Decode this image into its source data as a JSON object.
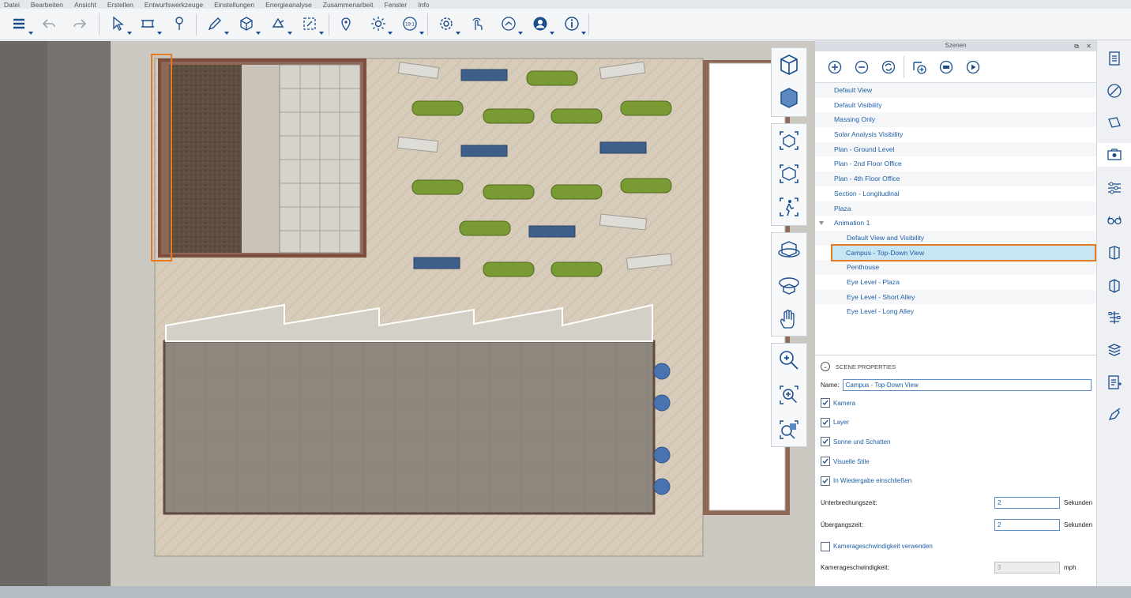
{
  "menu": [
    "Datei",
    "Bearbeiten",
    "Ansicht",
    "Erstellen",
    "Entwurfswerkzeuge",
    "Einstellungen",
    "Energieanalyse",
    "Zusammenarbeit",
    "Fenster",
    "Info"
  ],
  "toolbar": {
    "icons": [
      "layers-icon",
      "undo-icon",
      "redo-icon",
      "select-icon",
      "measure-icon",
      "pin-icon",
      "draw-icon",
      "box-icon",
      "surface-icon",
      "components-icon",
      "location-icon",
      "sun-icon",
      "time-icon",
      "settings-icon",
      "touch-icon",
      "share-icon",
      "account-icon",
      "info-icon"
    ],
    "time_badge": "19:1"
  },
  "scenes_panel": {
    "title": "Szenen",
    "toolbar_icons": [
      "add-scene-icon",
      "remove-scene-icon",
      "update-scene-icon",
      "add-animation-icon",
      "record-icon",
      "play-icon"
    ],
    "items": [
      {
        "label": "Default View",
        "level": 0
      },
      {
        "label": "Default Visibility",
        "level": 0
      },
      {
        "label": "Massing Only",
        "level": 0
      },
      {
        "label": "Solar Analysis Visibility",
        "level": 0
      },
      {
        "label": "Plan - Ground Level",
        "level": 0
      },
      {
        "label": "Plan - 2nd Floor Office",
        "level": 0
      },
      {
        "label": "Plan - 4th Floor Office",
        "level": 0
      },
      {
        "label": "Section - Longitudinal",
        "level": 0
      },
      {
        "label": "Plaza",
        "level": 0
      },
      {
        "label": "Animation 1",
        "level": 0,
        "group": true
      },
      {
        "label": "Default View and Visibility",
        "level": 1
      },
      {
        "label": "Campus - Top-Down View",
        "level": 1,
        "selected": true
      },
      {
        "label": "Penthouse",
        "level": 1
      },
      {
        "label": "Eye Level - Plaza",
        "level": 1
      },
      {
        "label": "Eye Level - Short Alley",
        "level": 1
      },
      {
        "label": "Eye Level - Long Alley",
        "level": 1
      }
    ]
  },
  "scene_properties": {
    "header": "SCENE PROPERTIES",
    "name_label": "Name:",
    "name_value": "Campus - Top-Down View",
    "checkboxes": {
      "kamera": {
        "label": "Kamera",
        "checked": true
      },
      "layer": {
        "label": "Layer",
        "checked": true
      },
      "sonne": {
        "label": "Sonne und Schatten",
        "checked": true
      },
      "stile": {
        "label": "Visuelle Stile",
        "checked": true
      },
      "wiedergabe": {
        "label": "In Wiedergabe einschließen",
        "checked": true
      },
      "geschw": {
        "label": "Kamerageschwindigkeit verwenden",
        "checked": false
      }
    },
    "pause_label": "Unterbrechungszeit:",
    "pause_value": "2",
    "pause_unit": "Sekunden",
    "transition_label": "Übergangszeit:",
    "transition_value": "2",
    "transition_unit": "Sekunden",
    "speed_label": "Kamerageschwindigkeit:",
    "speed_value": "3",
    "speed_unit": "mph"
  },
  "nav_icons": [
    "top-view-icon",
    "bottom-view-icon",
    "orbit-view-icon",
    "default-view-icon",
    "walk-view-icon",
    "orbit-3d-icon",
    "turntable-icon",
    "pan-hand-icon",
    "zoom-icon",
    "zoom-window-icon",
    "zoom-extents-icon"
  ],
  "right_sidebar_icons": [
    "properties-icon",
    "style-icon",
    "materials-icon",
    "scenes-icon",
    "layers-panel-icon",
    "viewpoint-icon",
    "components-panel-icon",
    "sections-icon",
    "structure-icon",
    "stack-icon",
    "notes-icon",
    "paint-icon"
  ],
  "colors": {
    "accent": "#1f5fa3",
    "selection_fill": "#c7e5f3",
    "highlight_outline": "#e57c23"
  }
}
